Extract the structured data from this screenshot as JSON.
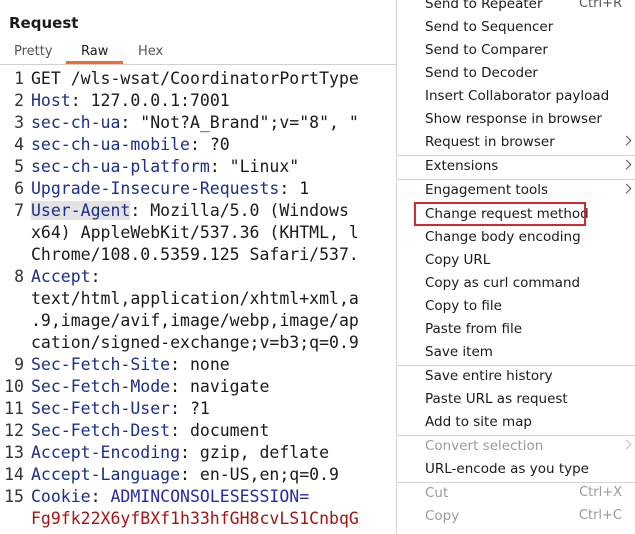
{
  "panel": {
    "title": "Request"
  },
  "tabs": [
    {
      "label": "Pretty"
    },
    {
      "label": "Raw"
    },
    {
      "label": "Hex"
    }
  ],
  "editor": {
    "lines": [
      {
        "num": "1",
        "key": "",
        "text": "GET /wls-wsat/CoordinatorPortType"
      },
      {
        "num": "2",
        "key": "Host",
        "text": ": 127.0.0.1:7001"
      },
      {
        "num": "3",
        "key": "sec-ch-ua",
        "text": ": \"Not?A_Brand\";v=\"8\", \""
      },
      {
        "num": "4",
        "key": "sec-ch-ua-mobile",
        "text": ": ?0"
      },
      {
        "num": "5",
        "key": "sec-ch-ua-platform",
        "text": ": \"Linux\""
      },
      {
        "num": "6",
        "key": "Upgrade-Insecure-Requests",
        "text": ": 1"
      },
      {
        "num": "7",
        "key": "User-Agent",
        "text": ": Mozilla/5.0 (Windows "
      },
      {
        "num": "",
        "key": "",
        "text": "x64) AppleWebKit/537.36 (KHTML, l"
      },
      {
        "num": "",
        "key": "",
        "text": "Chrome/108.0.5359.125 Safari/537."
      },
      {
        "num": "8",
        "key": "Accept",
        "text": ":"
      },
      {
        "num": "",
        "key": "",
        "text": "text/html,application/xhtml+xml,a"
      },
      {
        "num": "",
        "key": "",
        "text": ".9,image/avif,image/webp,image/ap"
      },
      {
        "num": "",
        "key": "",
        "text": "cation/signed-exchange;v=b3;q=0.9"
      },
      {
        "num": "9",
        "key": "Sec-Fetch-Site",
        "text": ": none"
      },
      {
        "num": "10",
        "key": "Sec-Fetch-Mode",
        "text": ": navigate"
      },
      {
        "num": "11",
        "key": "Sec-Fetch-User",
        "text": ": ?1"
      },
      {
        "num": "12",
        "key": "Sec-Fetch-Dest",
        "text": ": document"
      },
      {
        "num": "13",
        "key": "Accept-Encoding",
        "text": ": gzip, deflate"
      },
      {
        "num": "14",
        "key": "Accept-Language",
        "text": ": en-US,en;q=0.9"
      },
      {
        "num": "15",
        "key": "Cookie",
        "text": ": "
      },
      {
        "num": "",
        "key": "",
        "text": "Fg9fk22X6yfBXf1h33hfGH8cvLS1CnbqG"
      }
    ],
    "cookie_name": "ADMINCONSOLESESSION="
  },
  "menu": {
    "items": [
      {
        "label": "Send to Repeater",
        "shortcut": "Ctrl+R"
      },
      {
        "label": "Send to Sequencer"
      },
      {
        "label": "Send to Comparer"
      },
      {
        "label": "Send to Decoder"
      },
      {
        "label": "Insert Collaborator payload"
      },
      {
        "label": "Show response in browser"
      },
      {
        "label": "Request in browser"
      },
      {
        "label": "Extensions"
      },
      {
        "label": "Engagement tools"
      },
      {
        "label": "Change request method"
      },
      {
        "label": "Change body encoding"
      },
      {
        "label": "Copy URL"
      },
      {
        "label": "Copy as curl command"
      },
      {
        "label": "Copy to file"
      },
      {
        "label": "Paste from file"
      },
      {
        "label": "Save item"
      },
      {
        "label": "Save entire history"
      },
      {
        "label": "Paste URL as request"
      },
      {
        "label": "Add to site map"
      },
      {
        "label": "Convert selection"
      },
      {
        "label": "URL-encode as you type"
      },
      {
        "label": "Cut",
        "shortcut": "Ctrl+X"
      },
      {
        "label": "Copy",
        "shortcut": "Ctrl+C"
      }
    ]
  },
  "colors": {
    "accent": "#f5692b",
    "highlight_box": "#d9262a",
    "header_key": "#1b2e8c"
  }
}
